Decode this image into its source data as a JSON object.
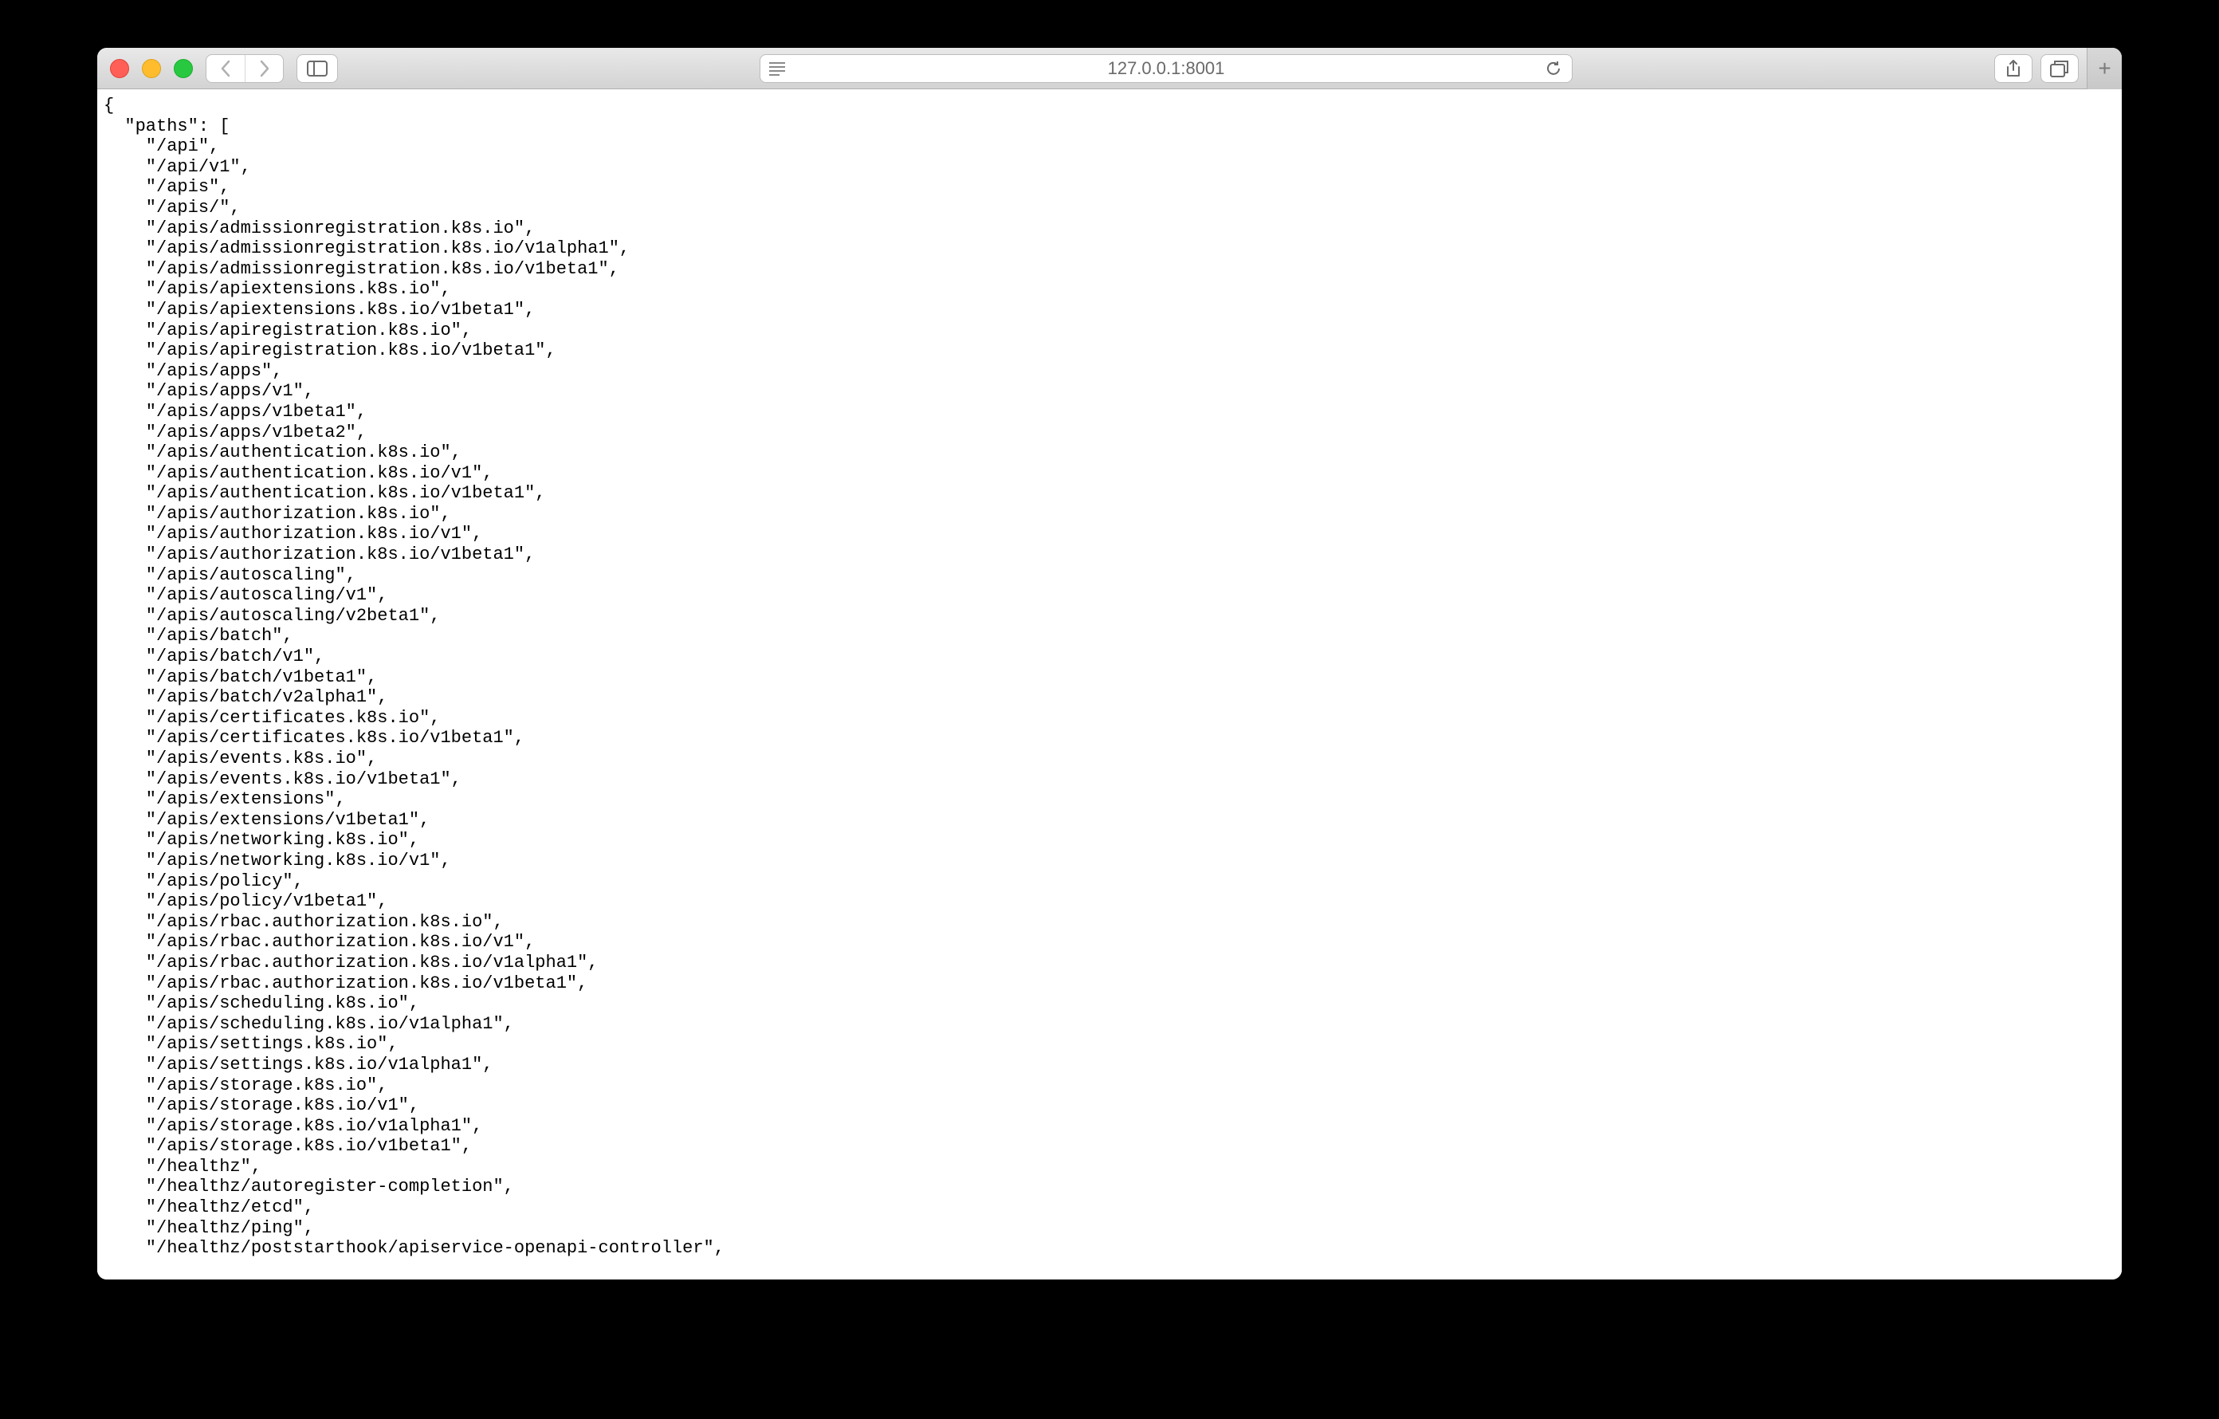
{
  "toolbar": {
    "address": "127.0.0.1:8001"
  },
  "content": {
    "paths_label": "paths",
    "paths": [
      "/api",
      "/api/v1",
      "/apis",
      "/apis/",
      "/apis/admissionregistration.k8s.io",
      "/apis/admissionregistration.k8s.io/v1alpha1",
      "/apis/admissionregistration.k8s.io/v1beta1",
      "/apis/apiextensions.k8s.io",
      "/apis/apiextensions.k8s.io/v1beta1",
      "/apis/apiregistration.k8s.io",
      "/apis/apiregistration.k8s.io/v1beta1",
      "/apis/apps",
      "/apis/apps/v1",
      "/apis/apps/v1beta1",
      "/apis/apps/v1beta2",
      "/apis/authentication.k8s.io",
      "/apis/authentication.k8s.io/v1",
      "/apis/authentication.k8s.io/v1beta1",
      "/apis/authorization.k8s.io",
      "/apis/authorization.k8s.io/v1",
      "/apis/authorization.k8s.io/v1beta1",
      "/apis/autoscaling",
      "/apis/autoscaling/v1",
      "/apis/autoscaling/v2beta1",
      "/apis/batch",
      "/apis/batch/v1",
      "/apis/batch/v1beta1",
      "/apis/batch/v2alpha1",
      "/apis/certificates.k8s.io",
      "/apis/certificates.k8s.io/v1beta1",
      "/apis/events.k8s.io",
      "/apis/events.k8s.io/v1beta1",
      "/apis/extensions",
      "/apis/extensions/v1beta1",
      "/apis/networking.k8s.io",
      "/apis/networking.k8s.io/v1",
      "/apis/policy",
      "/apis/policy/v1beta1",
      "/apis/rbac.authorization.k8s.io",
      "/apis/rbac.authorization.k8s.io/v1",
      "/apis/rbac.authorization.k8s.io/v1alpha1",
      "/apis/rbac.authorization.k8s.io/v1beta1",
      "/apis/scheduling.k8s.io",
      "/apis/scheduling.k8s.io/v1alpha1",
      "/apis/settings.k8s.io",
      "/apis/settings.k8s.io/v1alpha1",
      "/apis/storage.k8s.io",
      "/apis/storage.k8s.io/v1",
      "/apis/storage.k8s.io/v1alpha1",
      "/apis/storage.k8s.io/v1beta1",
      "/healthz",
      "/healthz/autoregister-completion",
      "/healthz/etcd",
      "/healthz/ping",
      "/healthz/poststarthook/apiservice-openapi-controller"
    ]
  }
}
